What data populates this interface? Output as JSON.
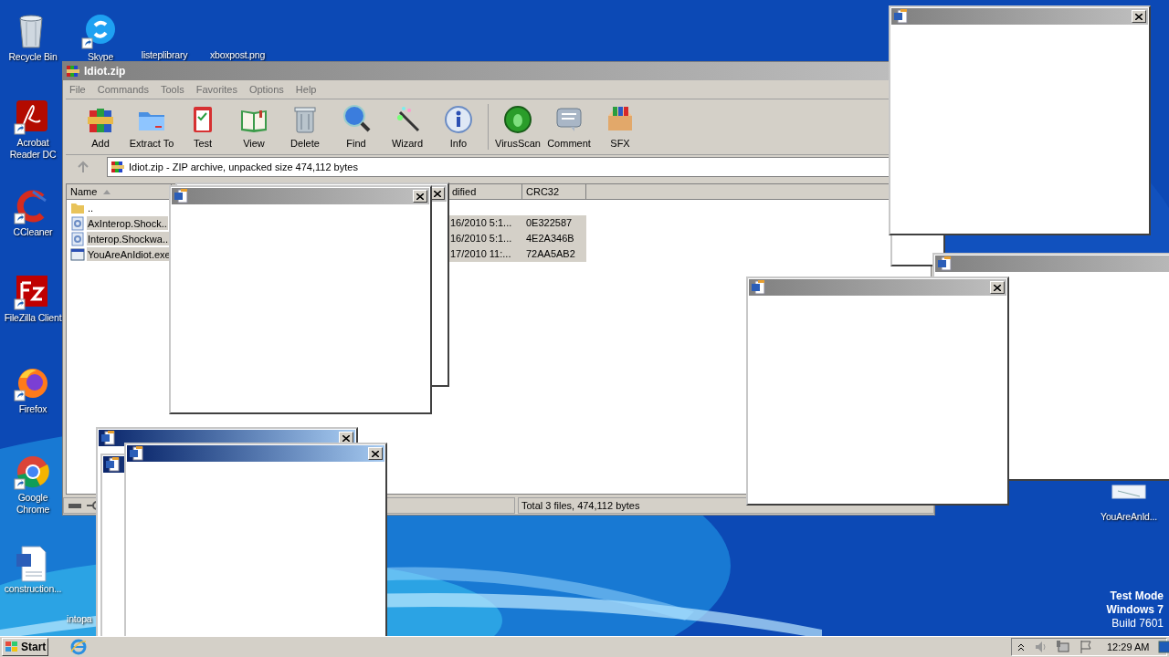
{
  "desktop_icons": [
    {
      "label": "Recycle Bin"
    },
    {
      "label": "Skype"
    },
    {
      "label": "listeplibrary"
    },
    {
      "label": "xboxpost.png"
    },
    {
      "label": "Acrobat Reader DC"
    },
    {
      "label": "CCleaner"
    },
    {
      "label": "FileZilla Client"
    },
    {
      "label": "Firefox"
    },
    {
      "label": "Google Chrome"
    },
    {
      "label": "construction..."
    },
    {
      "label": "intopa"
    },
    {
      "label": "YouAreAnId..."
    }
  ],
  "archiver": {
    "title": "Idiot.zip",
    "menu": [
      "File",
      "Commands",
      "Tools",
      "Favorites",
      "Options",
      "Help"
    ],
    "toolbar": [
      "Add",
      "Extract To",
      "Test",
      "View",
      "Delete",
      "Find",
      "Wizard",
      "Info",
      "VirusScan",
      "Comment",
      "SFX"
    ],
    "address": "Idiot.zip - ZIP archive, unpacked size 474,112 bytes",
    "columns": [
      "Name",
      "dified",
      "CRC32"
    ],
    "rows": [
      {
        "kind": "parent",
        "name": "..",
        "selected": false
      },
      {
        "kind": "dll",
        "name": "AxInterop.Shock..",
        "modified": "16/2010 5:1...",
        "crc32": "0E322587",
        "selected": true
      },
      {
        "kind": "dll",
        "name": "Interop.Shockwa..",
        "modified": "16/2010 5:1...",
        "crc32": "4E2A346B",
        "selected": true
      },
      {
        "kind": "exe",
        "name": "YouAreAnIdiot.exe",
        "modified": "17/2010 11:...",
        "crc32": "72AA5AB2",
        "selected": true
      }
    ],
    "status": "Total 3 files, 474,112 bytes"
  },
  "popups": [
    {
      "active": false
    },
    {
      "active": false
    },
    {
      "active": false
    },
    {
      "active": false
    },
    {
      "active": false
    },
    {
      "active": true
    },
    {
      "active": true
    },
    {
      "active": true
    }
  ],
  "os_notice": {
    "line_1": "Test Mode",
    "line_2": "Windows 7",
    "line_3": "Build 7601"
  },
  "taskbar": {
    "start": "Start",
    "clock": "12:29 AM"
  }
}
